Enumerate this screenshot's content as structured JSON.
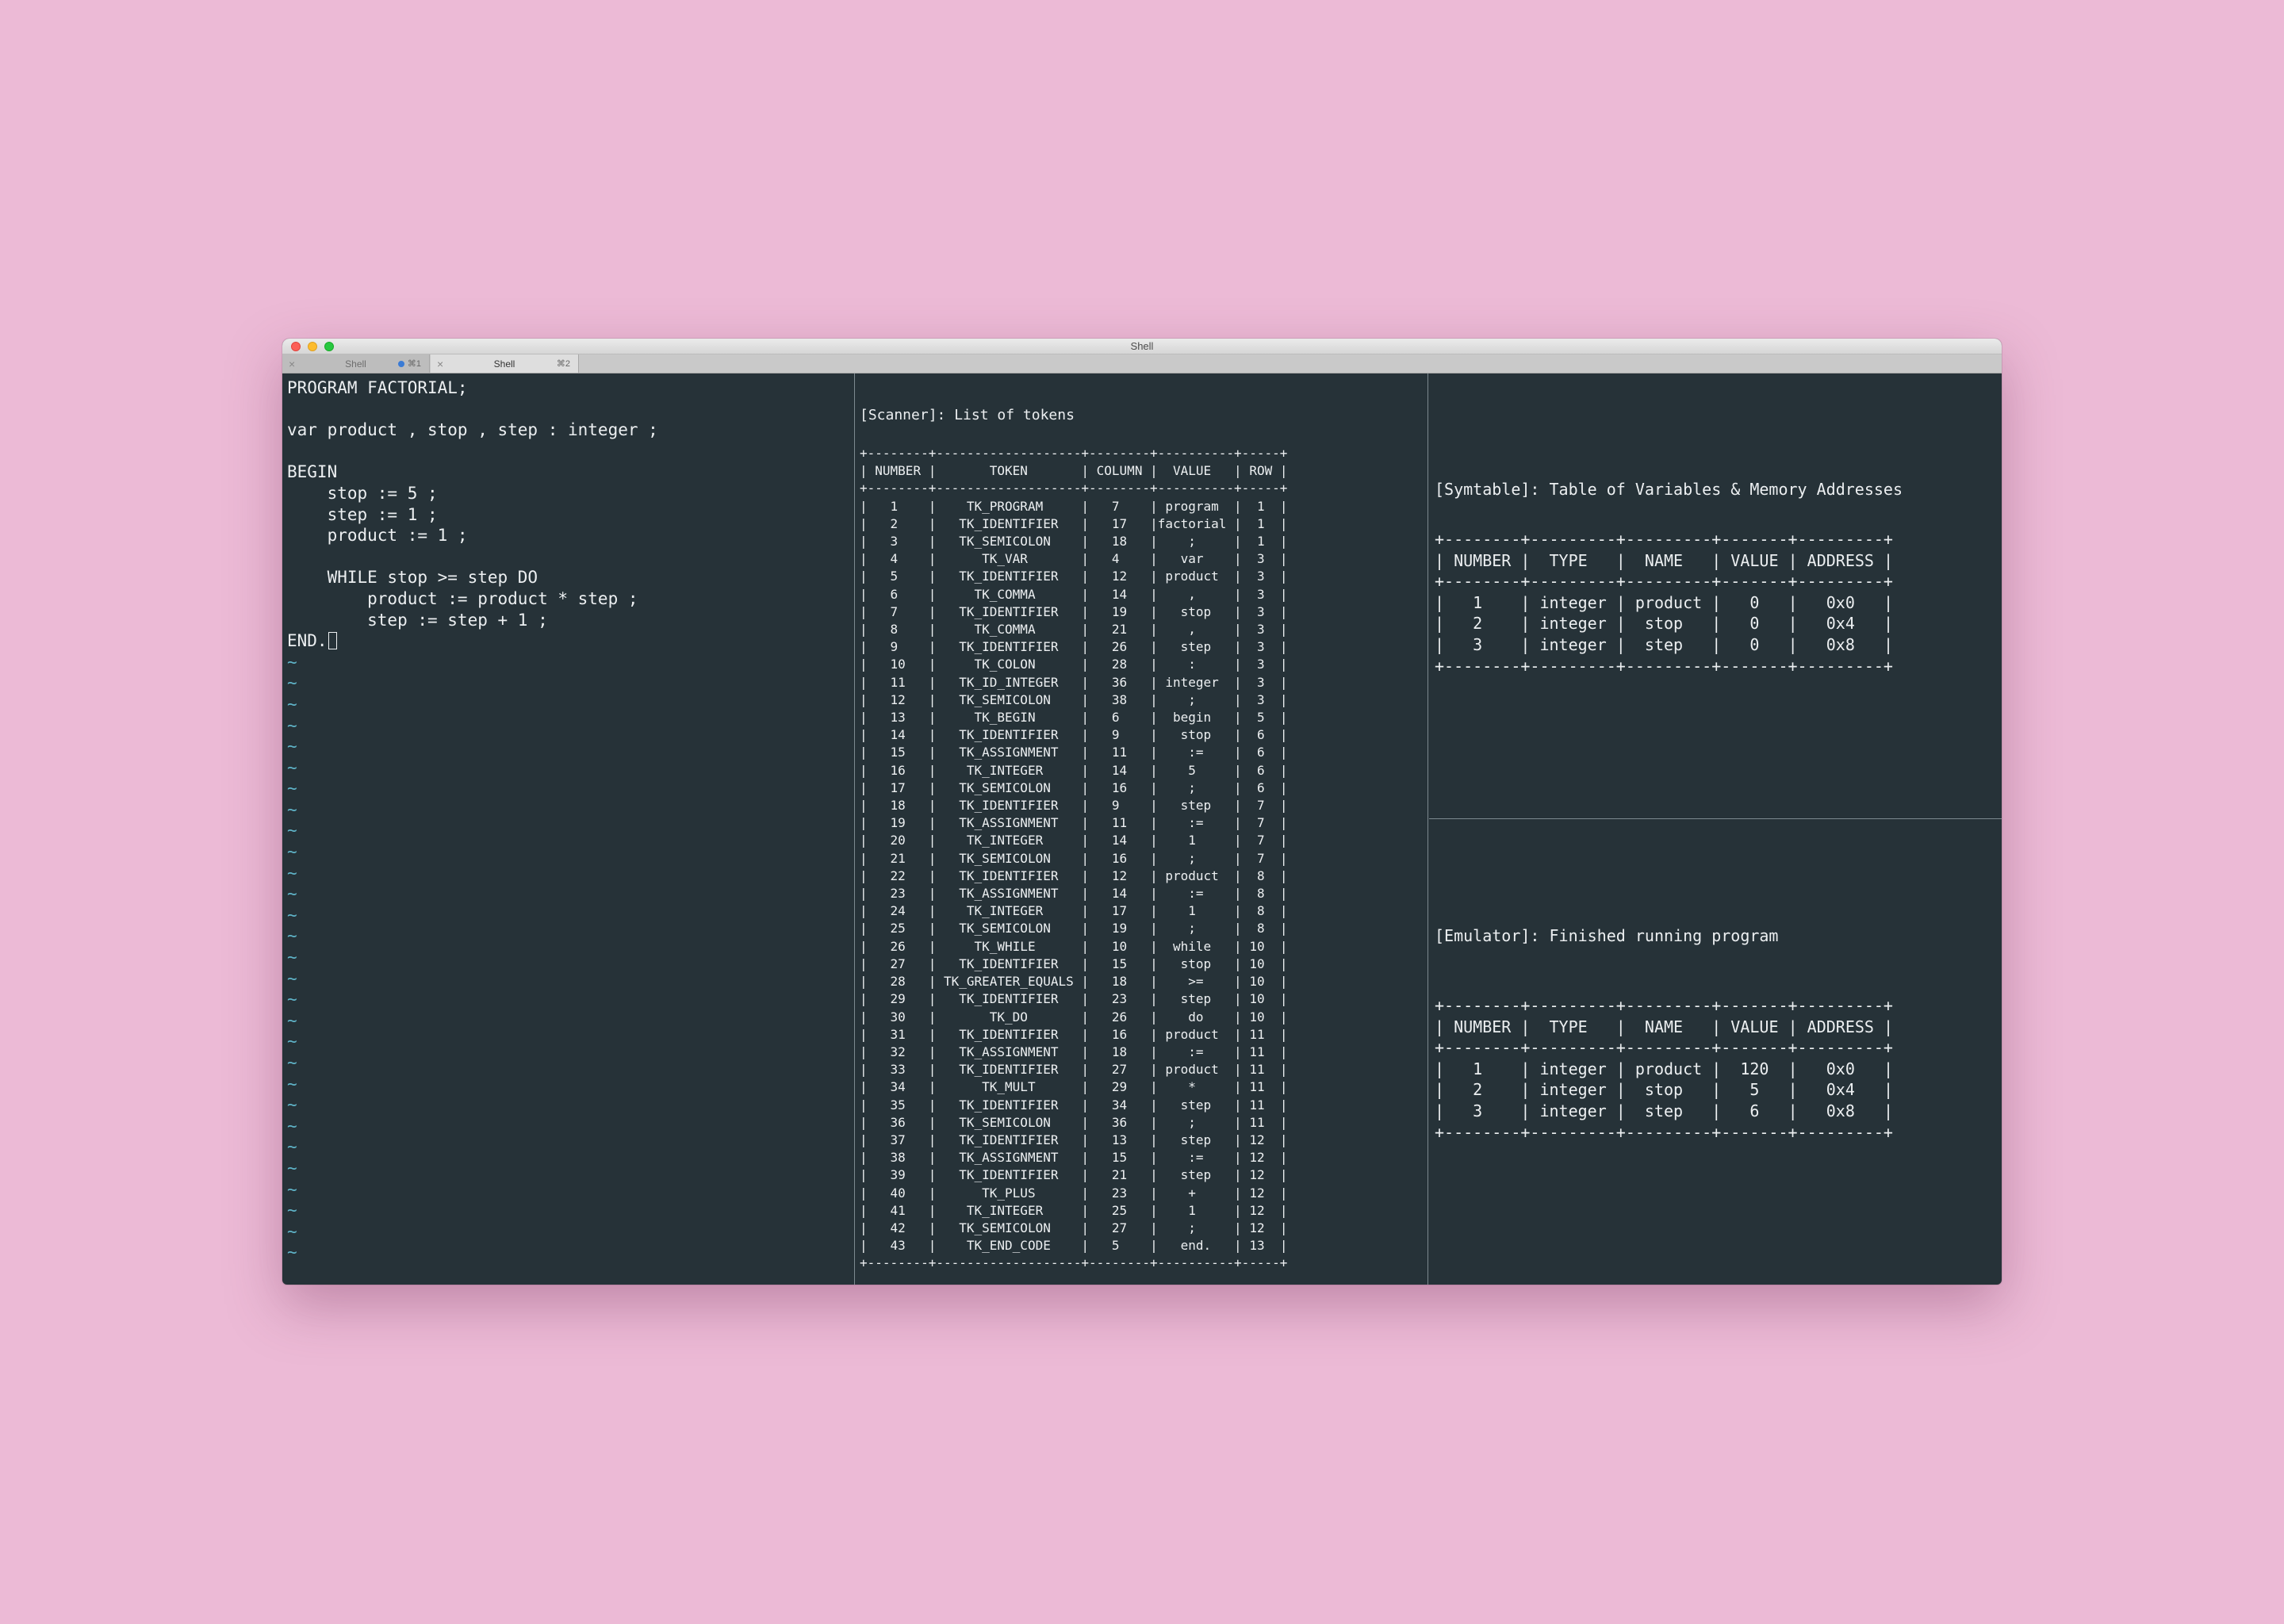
{
  "window": {
    "title": "Shell",
    "tabs": [
      {
        "label": "Shell",
        "shortcut": "⌘1"
      },
      {
        "label": "Shell",
        "shortcut": "⌘2"
      }
    ]
  },
  "editor": {
    "lines": [
      "PROGRAM FACTORIAL;",
      "",
      "var product , stop , step : integer ;",
      "",
      "BEGIN",
      "    stop := 5 ;",
      "    step := 1 ;",
      "    product := 1 ;",
      "",
      "    WHILE stop >= step DO",
      "        product := product * step ;",
      "        step := step + 1 ;"
    ],
    "last_line": "END.",
    "tilde_count": 29
  },
  "scanner": {
    "title": "[Scanner]: List of tokens",
    "columns": [
      "NUMBER",
      "TOKEN",
      "COLUMN",
      "VALUE",
      "ROW"
    ],
    "rows": [
      [
        "1",
        "TK_PROGRAM",
        "7",
        "program",
        "1"
      ],
      [
        "2",
        "TK_IDENTIFIER",
        "17",
        "factorial",
        "1"
      ],
      [
        "3",
        "TK_SEMICOLON",
        "18",
        ";",
        "1"
      ],
      [
        "4",
        "TK_VAR",
        "4",
        "var",
        "3"
      ],
      [
        "5",
        "TK_IDENTIFIER",
        "12",
        "product",
        "3"
      ],
      [
        "6",
        "TK_COMMA",
        "14",
        ",",
        "3"
      ],
      [
        "7",
        "TK_IDENTIFIER",
        "19",
        "stop",
        "3"
      ],
      [
        "8",
        "TK_COMMA",
        "21",
        ",",
        "3"
      ],
      [
        "9",
        "TK_IDENTIFIER",
        "26",
        "step",
        "3"
      ],
      [
        "10",
        "TK_COLON",
        "28",
        ":",
        "3"
      ],
      [
        "11",
        "TK_ID_INTEGER",
        "36",
        "integer",
        "3"
      ],
      [
        "12",
        "TK_SEMICOLON",
        "38",
        ";",
        "3"
      ],
      [
        "13",
        "TK_BEGIN",
        "6",
        "begin",
        "5"
      ],
      [
        "14",
        "TK_IDENTIFIER",
        "9",
        "stop",
        "6"
      ],
      [
        "15",
        "TK_ASSIGNMENT",
        "11",
        ":=",
        "6"
      ],
      [
        "16",
        "TK_INTEGER",
        "14",
        "5",
        "6"
      ],
      [
        "17",
        "TK_SEMICOLON",
        "16",
        ";",
        "6"
      ],
      [
        "18",
        "TK_IDENTIFIER",
        "9",
        "step",
        "7"
      ],
      [
        "19",
        "TK_ASSIGNMENT",
        "11",
        ":=",
        "7"
      ],
      [
        "20",
        "TK_INTEGER",
        "14",
        "1",
        "7"
      ],
      [
        "21",
        "TK_SEMICOLON",
        "16",
        ";",
        "7"
      ],
      [
        "22",
        "TK_IDENTIFIER",
        "12",
        "product",
        "8"
      ],
      [
        "23",
        "TK_ASSIGNMENT",
        "14",
        ":=",
        "8"
      ],
      [
        "24",
        "TK_INTEGER",
        "17",
        "1",
        "8"
      ],
      [
        "25",
        "TK_SEMICOLON",
        "19",
        ";",
        "8"
      ],
      [
        "26",
        "TK_WHILE",
        "10",
        "while",
        "10"
      ],
      [
        "27",
        "TK_IDENTIFIER",
        "15",
        "stop",
        "10"
      ],
      [
        "28",
        "TK_GREATER_EQUALS",
        "18",
        ">=",
        "10"
      ],
      [
        "29",
        "TK_IDENTIFIER",
        "23",
        "step",
        "10"
      ],
      [
        "30",
        "TK_DO",
        "26",
        "do",
        "10"
      ],
      [
        "31",
        "TK_IDENTIFIER",
        "16",
        "product",
        "11"
      ],
      [
        "32",
        "TK_ASSIGNMENT",
        "18",
        ":=",
        "11"
      ],
      [
        "33",
        "TK_IDENTIFIER",
        "27",
        "product",
        "11"
      ],
      [
        "34",
        "TK_MULT",
        "29",
        "*",
        "11"
      ],
      [
        "35",
        "TK_IDENTIFIER",
        "34",
        "step",
        "11"
      ],
      [
        "36",
        "TK_SEMICOLON",
        "36",
        ";",
        "11"
      ],
      [
        "37",
        "TK_IDENTIFIER",
        "13",
        "step",
        "12"
      ],
      [
        "38",
        "TK_ASSIGNMENT",
        "15",
        ":=",
        "12"
      ],
      [
        "39",
        "TK_IDENTIFIER",
        "21",
        "step",
        "12"
      ],
      [
        "40",
        "TK_PLUS",
        "23",
        "+",
        "12"
      ],
      [
        "41",
        "TK_INTEGER",
        "25",
        "1",
        "12"
      ],
      [
        "42",
        "TK_SEMICOLON",
        "27",
        ";",
        "12"
      ],
      [
        "43",
        "TK_END_CODE",
        "5",
        "end.",
        "13"
      ]
    ]
  },
  "symtable": {
    "title": "[Symtable]: Table of Variables & Memory Addresses",
    "columns": [
      "NUMBER",
      "TYPE",
      "NAME",
      "VALUE",
      "ADDRESS"
    ],
    "rows": [
      [
        "1",
        "integer",
        "product",
        "0",
        "0x0"
      ],
      [
        "2",
        "integer",
        "stop",
        "0",
        "0x4"
      ],
      [
        "3",
        "integer",
        "step",
        "0",
        "0x8"
      ]
    ]
  },
  "emulator": {
    "title": "[Emulator]: Finished running program",
    "columns": [
      "NUMBER",
      "TYPE",
      "NAME",
      "VALUE",
      "ADDRESS"
    ],
    "rows": [
      [
        "1",
        "integer",
        "product",
        "120",
        "0x0"
      ],
      [
        "2",
        "integer",
        "stop",
        "5",
        "0x4"
      ],
      [
        "3",
        "integer",
        "step",
        "6",
        "0x8"
      ]
    ]
  },
  "colors": {
    "desktop": "#ecbad6",
    "terminal_bg": "#263238",
    "terminal_fg": "#eceff1",
    "tilde": "#5fb4c8"
  }
}
